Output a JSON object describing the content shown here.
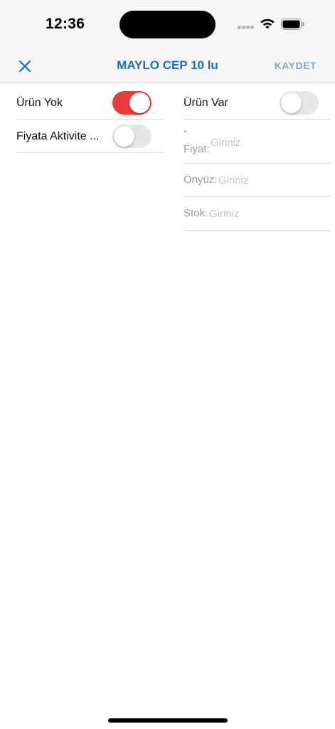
{
  "status_bar": {
    "time": "12:36"
  },
  "nav": {
    "title": "MAYLO CEP 10 lu",
    "save_label": "KAYDET",
    "close_icon": "close-icon"
  },
  "left_column": {
    "urun_yok": {
      "label": "Ürün Yok",
      "toggle_on": true
    },
    "fiyata_aktivite": {
      "label": "Fiyata Aktivite ...",
      "toggle_on": false
    }
  },
  "right_column": {
    "urun_var": {
      "label": "Ürün Var",
      "toggle_on": false
    },
    "fiyat": {
      "required_mark": "*",
      "label": "Fiyat:",
      "placeholder": "Giriniz",
      "value": ""
    },
    "onyuz": {
      "label": "Önyüz:",
      "placeholder": "Giriniz",
      "value": ""
    },
    "stok": {
      "label": "Stok:",
      "placeholder": "Giriniz",
      "value": ""
    }
  },
  "colors": {
    "accent_blue": "#1a6fb5",
    "save_blue": "#7ca7d0",
    "toggle_on_red": "#eb3b3b",
    "toggle_off_gray": "#e7e7e8"
  }
}
